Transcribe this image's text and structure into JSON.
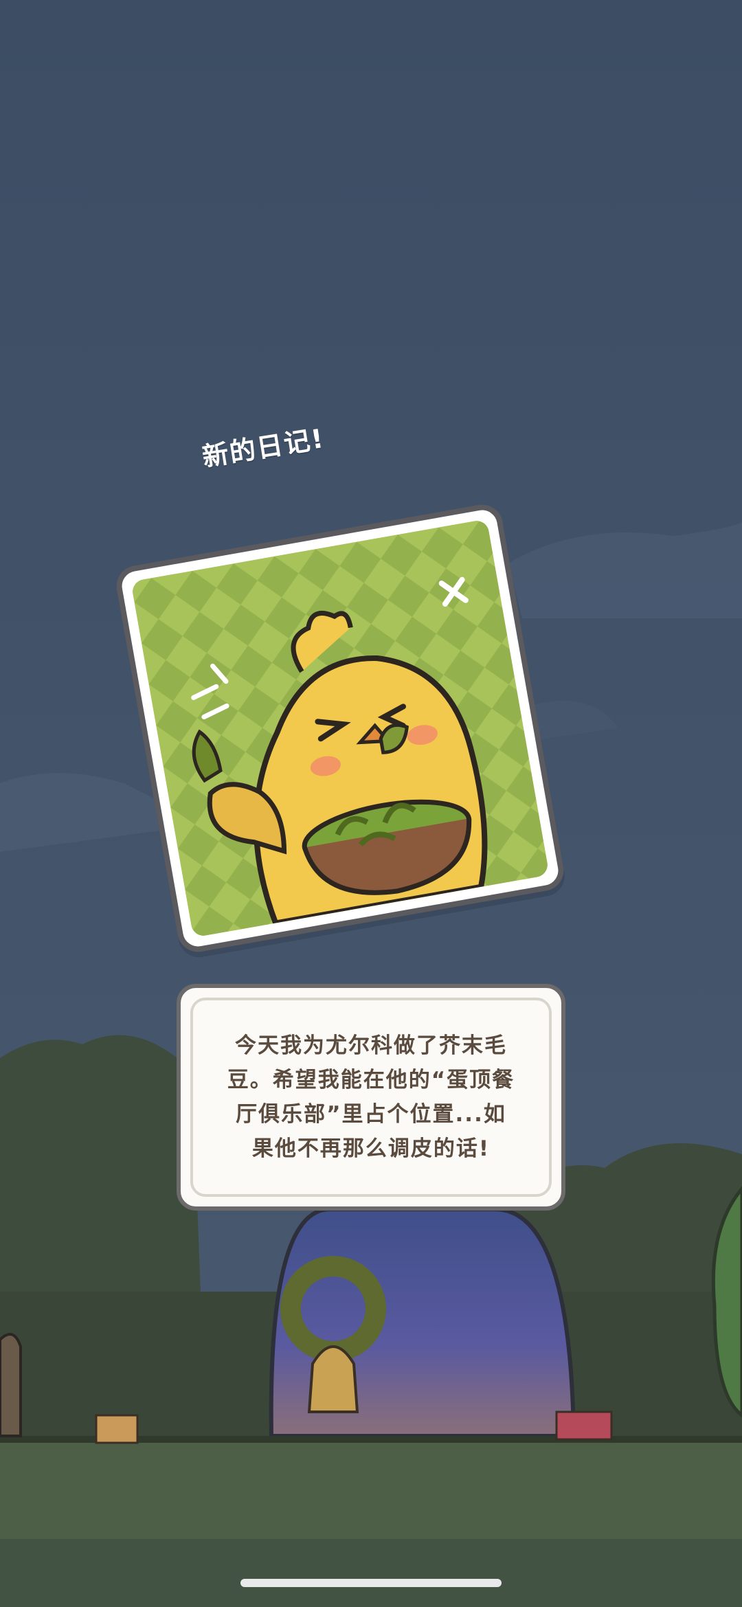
{
  "header": {
    "title": "新的日记!"
  },
  "diary": {
    "text": "今天我为尤尔科做了芥末毛豆。希望我能在他的“蛋顶餐厅俱乐部”里占个位置...如果他不再那么调皮的话!"
  },
  "card": {
    "icon": "chick-eating-edamame-icon"
  },
  "colors": {
    "sky": "#3f5067",
    "card_bg": "#a7c257",
    "text_brown": "#5b4b3f"
  }
}
